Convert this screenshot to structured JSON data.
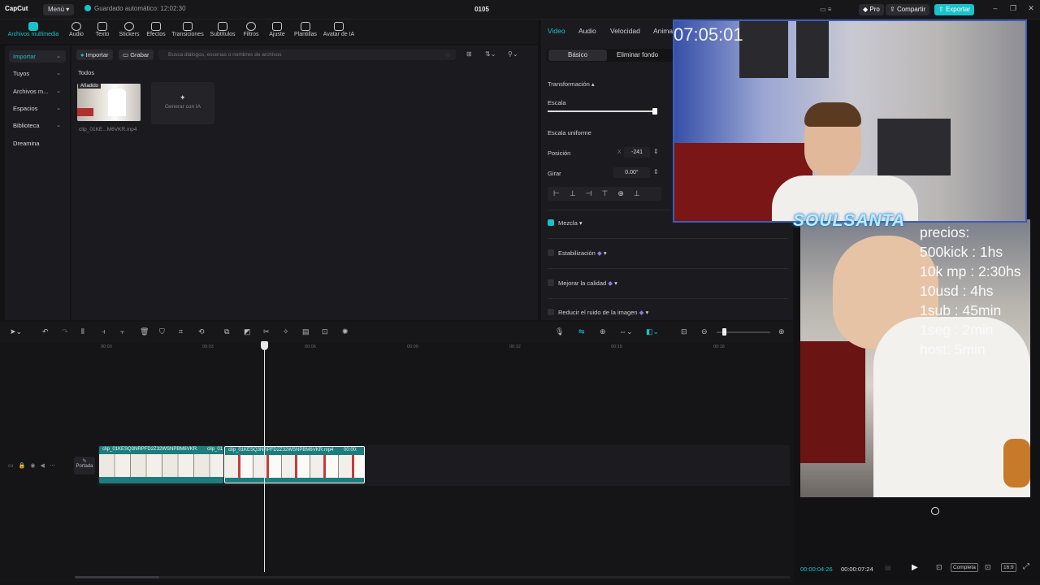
{
  "app": {
    "logo": "CapCut",
    "menu_label": "Menú",
    "autosave": "Guardado automático: 12:02:30",
    "project_title": "0105",
    "pro_label": "Pro",
    "share_label": "Compartir",
    "export_label": "Exportar",
    "accent": "#19c2c9"
  },
  "toolbar": {
    "items": [
      {
        "label": "Archivos multimedia",
        "icon": "media-icon"
      },
      {
        "label": "Audio",
        "icon": "audio-icon"
      },
      {
        "label": "Texto",
        "icon": "text-icon"
      },
      {
        "label": "Stickers",
        "icon": "sticker-icon"
      },
      {
        "label": "Efectos",
        "icon": "effects-icon"
      },
      {
        "label": "Transiciones",
        "icon": "transition-icon"
      },
      {
        "label": "Subtítulos",
        "icon": "subtitle-icon"
      },
      {
        "label": "Filtros",
        "icon": "filter-icon"
      },
      {
        "label": "Ajuste",
        "icon": "adjust-icon"
      },
      {
        "label": "Plantillas",
        "icon": "template-icon"
      },
      {
        "label": "Avatar de IA",
        "icon": "avatar-icon"
      }
    ]
  },
  "sidebar": {
    "items": [
      {
        "label": "Importar"
      },
      {
        "label": "Tuyos"
      },
      {
        "label": "Archivos m..."
      },
      {
        "label": "Espacios"
      },
      {
        "label": "Biblioteca"
      },
      {
        "label": "Dreamina"
      }
    ]
  },
  "media": {
    "import_label": "Importar",
    "record_label": "Grabar",
    "search_placeholder": "Busca diálogos, escenas o nombres de archivos",
    "section_label": "Todos",
    "clip_badge": "Añadido",
    "clip_name": "clip_01KE...M6VKR.mp4",
    "generate_label": "Generar con IA"
  },
  "properties": {
    "tabs": [
      "Video",
      "Audio",
      "Velocidad",
      "Anima"
    ],
    "subtabs": [
      "Básico",
      "Eliminar fondo"
    ],
    "section_transform": "Transformación",
    "scale_label": "Escala",
    "uniform_scale_label": "Escala uniforme",
    "position_label": "Posición",
    "position_x_axis": "X",
    "position_x": "-241",
    "rotate_label": "Girar",
    "rotate_value": "0.00°",
    "blend_label": "Mezcla",
    "stabilize_label": "Estabilización",
    "enhance_label": "Mejorar la calidad",
    "denoise_label": "Reducir el ruido de la imagen"
  },
  "timeline": {
    "ruler": [
      "00:00",
      "00:03",
      "00:06",
      "00:09",
      "00:12",
      "00:15",
      "00:18"
    ],
    "cover_label": "Portada",
    "clip1_name": "clip_01KESQ3NRPFD2Z32WSNPBM6VKR.",
    "clip1b_name": "clip_01",
    "clip2_name": "clip_01KESQ3NRPFD2Z32WSNPBM6VKR.mp4",
    "clip2_duration": "00:00:"
  },
  "preview": {
    "current_time": "00:00:04:26",
    "total_time": "00:00:07:24",
    "full_label": "Completa",
    "ratio_label": "16:9",
    "overlay_clock": "07:05:01",
    "watermark": "SOULSANTA",
    "prices": "precios:\n500kick : 1hs\n10k mp : 2:30hs\n10usd : 4hs\n1sub : 45min\n1seg : 2min\nhost: 5min"
  }
}
